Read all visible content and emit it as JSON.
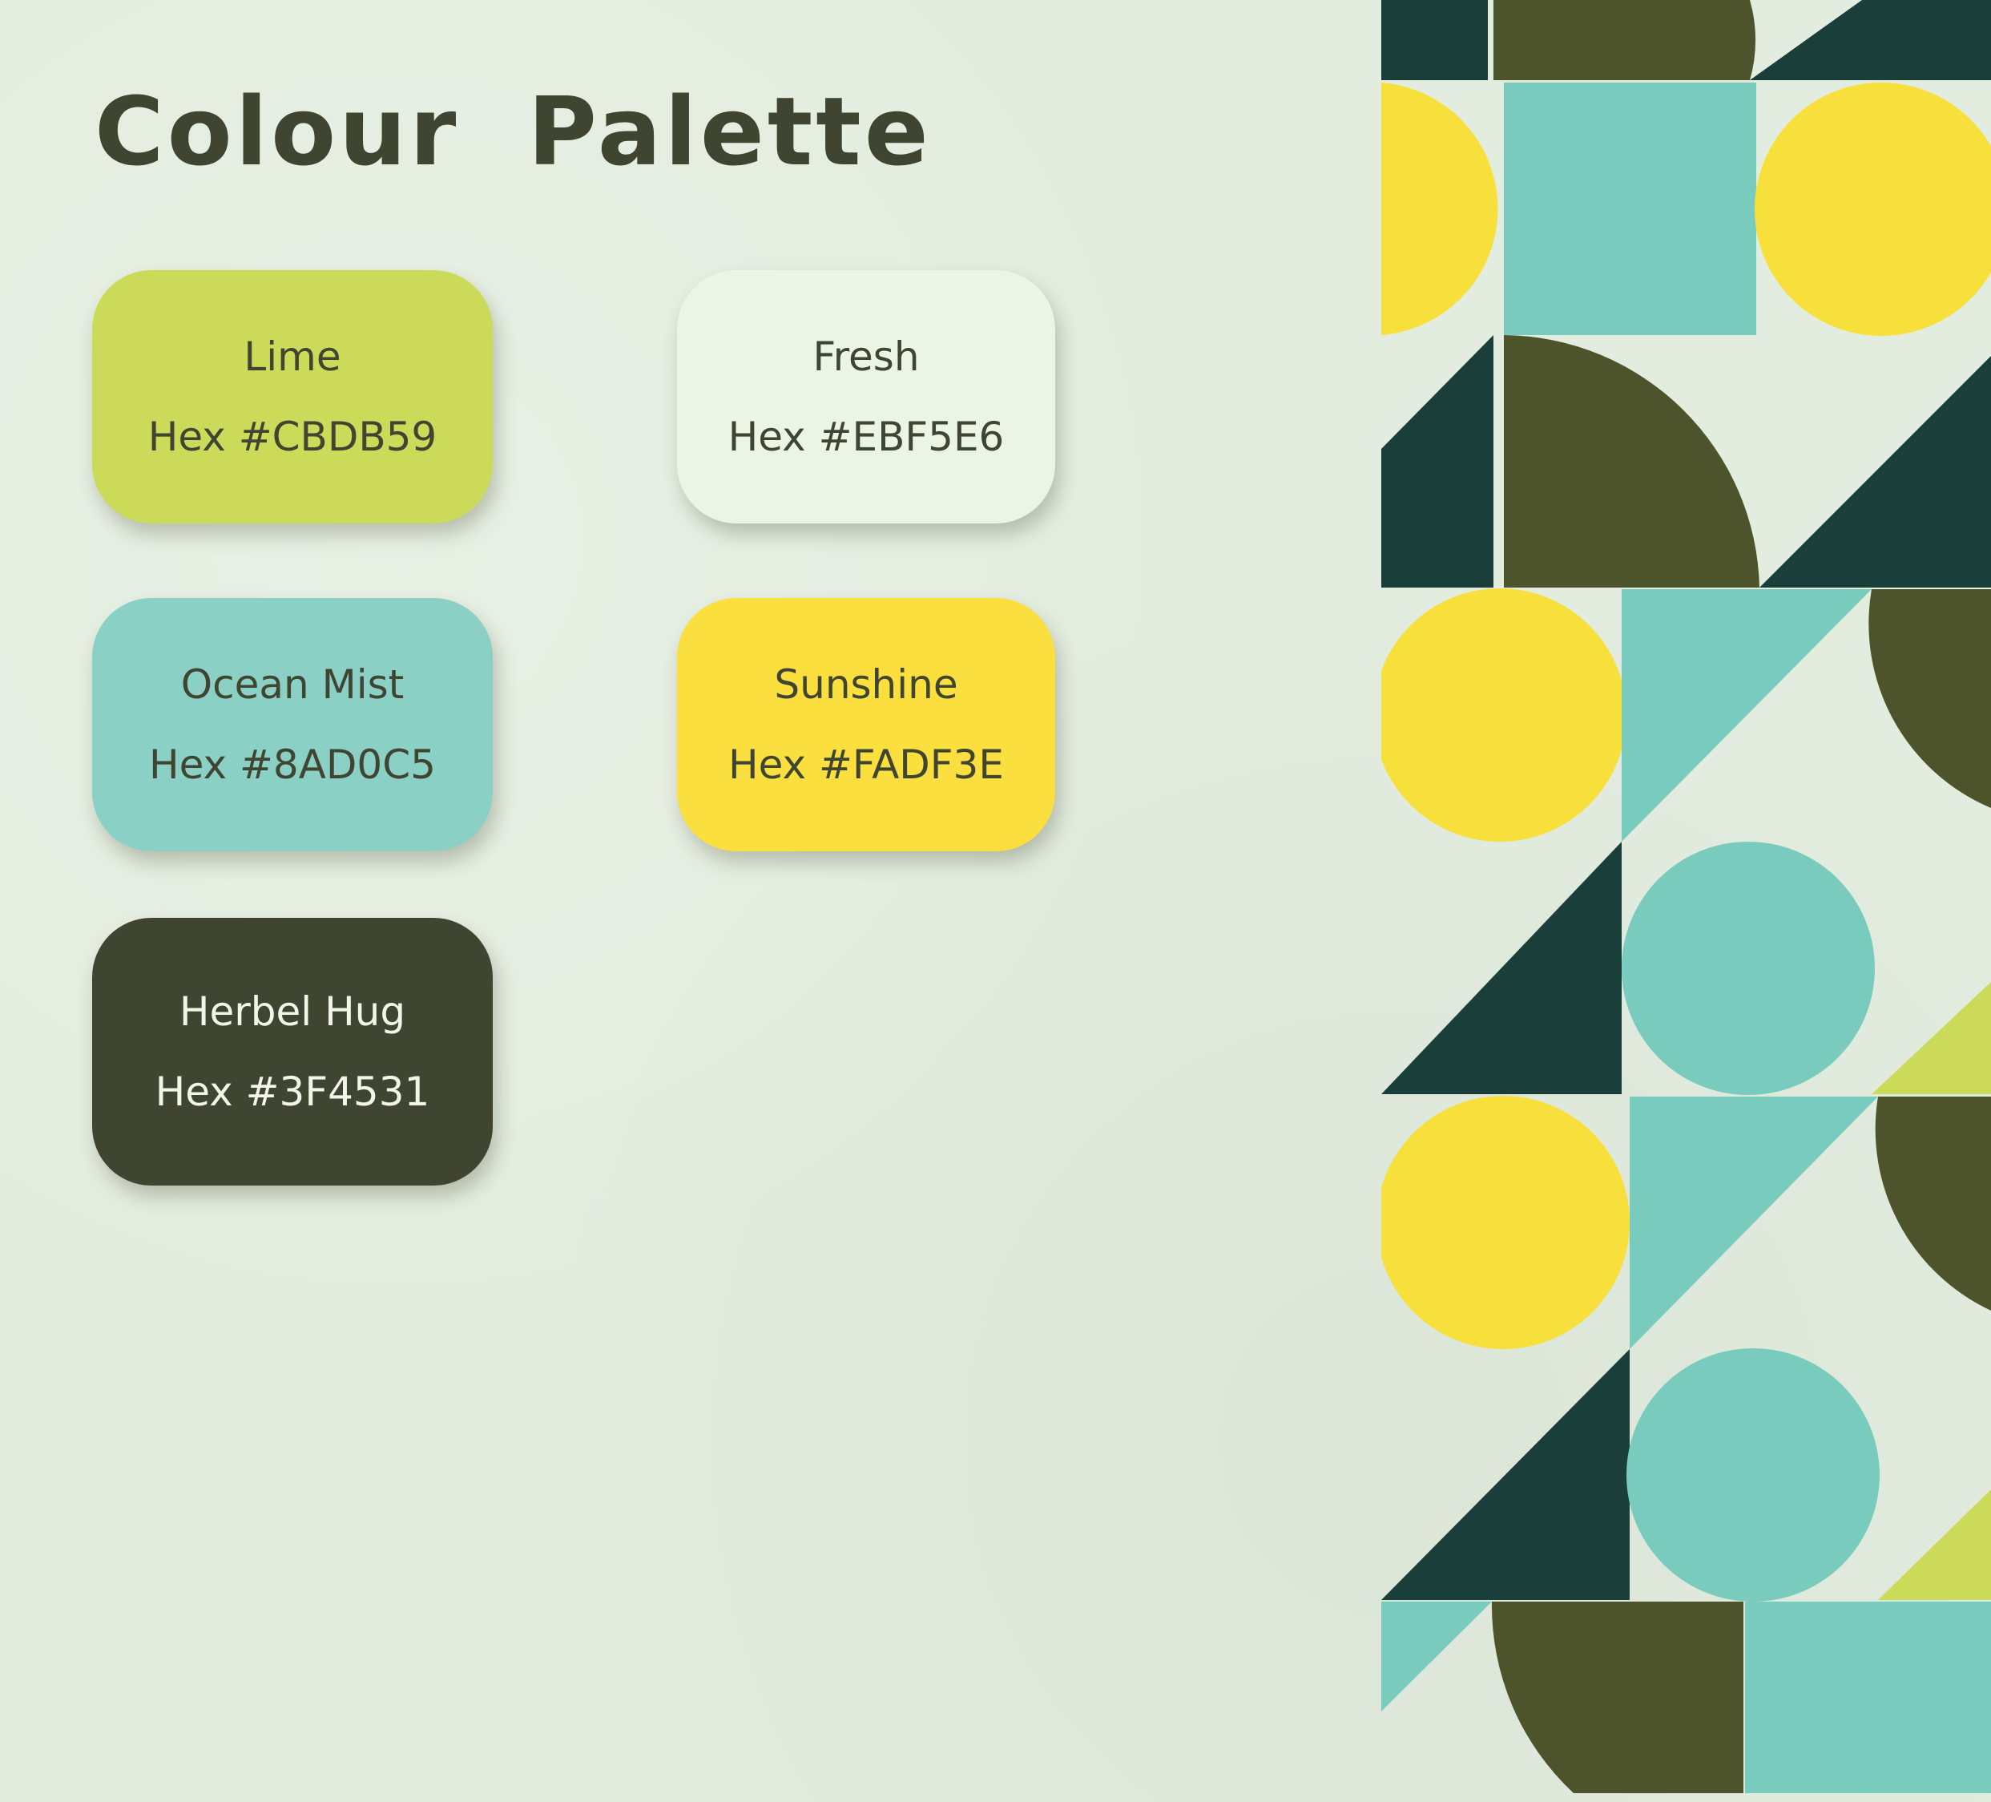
{
  "title": "Colour Palette",
  "colors": {
    "background": "#e3eddf",
    "dark_teal": "#1a3f3b",
    "olive": "#4d532b",
    "turquoise": "#79ccbd",
    "yellow": "#f7df3c",
    "lime": "#cbdb59"
  },
  "swatches": [
    {
      "name": "Lime",
      "hex": "Hex #CBDB59",
      "color": "#cbdb59"
    },
    {
      "name": "Fresh",
      "hex": "Hex #EBF5E6",
      "color": "#ebf5e6"
    },
    {
      "name": "Ocean Mist",
      "hex": "Hex #8AD0C5",
      "color": "#8ad0c5"
    },
    {
      "name": "Sunshine",
      "hex": "Hex #FADF3E",
      "color": "#fadf3e"
    },
    {
      "name": "Herbel Hug",
      "hex": "Hex #3F4531",
      "color": "#3f4531"
    }
  ]
}
